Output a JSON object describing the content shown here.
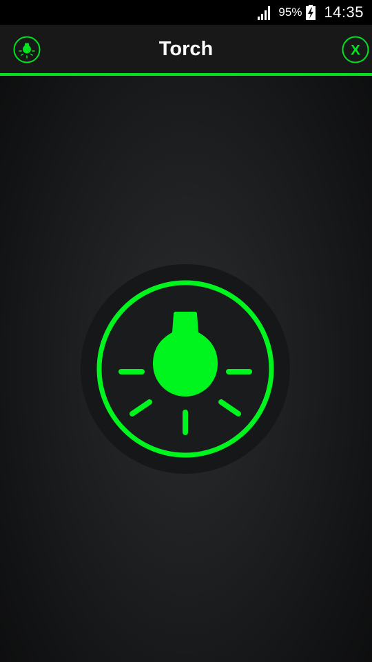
{
  "status_bar": {
    "battery_percent": "95%",
    "time": "14:35",
    "icons": [
      "signal-icon",
      "battery-charging-icon"
    ]
  },
  "app_bar": {
    "title": "Torch",
    "left_icon": "bulb-icon",
    "right_icon": "close-icon",
    "close_label": "X"
  },
  "torch": {
    "icon": "light-bulb-icon",
    "state": "on"
  },
  "colors": {
    "accent": "#00e31e",
    "bar_background": "#181818",
    "status_background": "#000000"
  }
}
